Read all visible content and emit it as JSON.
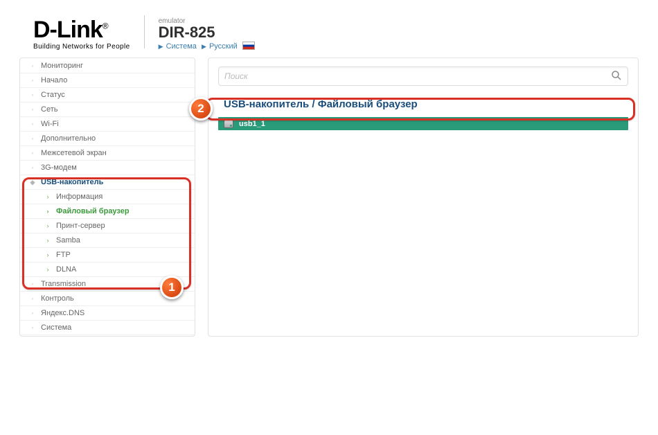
{
  "header": {
    "brand": "D-Link",
    "reg": "®",
    "tagline": "Building Networks for People",
    "emulator": "emulator",
    "model": "DIR-825",
    "crumb_system": "Система",
    "crumb_lang": "Русский"
  },
  "search": {
    "placeholder": "Поиск"
  },
  "page": {
    "title": "USB-накопитель /  Файловый браузер"
  },
  "file": {
    "name": "usb1_1"
  },
  "sidebar": {
    "items": [
      {
        "label": "Мониторинг"
      },
      {
        "label": "Начало"
      },
      {
        "label": "Статус"
      },
      {
        "label": "Сеть"
      },
      {
        "label": "Wi-Fi"
      },
      {
        "label": "Дополнительно"
      },
      {
        "label": "Межсетевой экран"
      },
      {
        "label": "3G-модем"
      },
      {
        "label": "USB-накопитель"
      },
      {
        "label": "Transmission"
      },
      {
        "label": "Контроль"
      },
      {
        "label": "Яндекс.DNS"
      },
      {
        "label": "Система"
      }
    ],
    "usb_children": [
      {
        "label": "Информация"
      },
      {
        "label": "Файловый браузер"
      },
      {
        "label": "Принт-сервер"
      },
      {
        "label": "Samba"
      },
      {
        "label": "FTP"
      },
      {
        "label": "DLNA"
      }
    ]
  },
  "annotations": {
    "step1": "1",
    "step2": "2"
  }
}
